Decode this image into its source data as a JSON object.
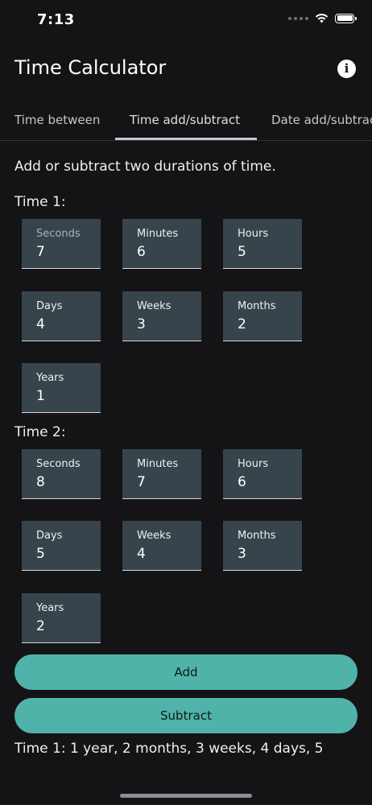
{
  "status": {
    "time": "7:13",
    "icons": [
      "cellular-dots-icon",
      "wifi-icon",
      "battery-icon"
    ]
  },
  "app": {
    "title": "Time Calculator",
    "info_icon": "info-icon",
    "info_glyph": "i"
  },
  "tabs": [
    {
      "label": "Time between",
      "active": false
    },
    {
      "label": "Time add/subtract",
      "active": true
    },
    {
      "label": "Date add/subtract",
      "active": false
    }
  ],
  "description": "Add or subtract two durations of time.",
  "time1": {
    "label": "Time 1:",
    "fields": [
      {
        "label": "Seconds",
        "value": "7"
      },
      {
        "label": "Minutes",
        "value": "6"
      },
      {
        "label": "Hours",
        "value": "5"
      },
      {
        "label": "Days",
        "value": "4"
      },
      {
        "label": "Weeks",
        "value": "3"
      },
      {
        "label": "Months",
        "value": "2"
      },
      {
        "label": "Years",
        "value": "1"
      }
    ]
  },
  "time2": {
    "label": "Time 2:",
    "fields": [
      {
        "label": "Seconds",
        "value": "8"
      },
      {
        "label": "Minutes",
        "value": "7"
      },
      {
        "label": "Hours",
        "value": "6"
      },
      {
        "label": "Days",
        "value": "5"
      },
      {
        "label": "Weeks",
        "value": "4"
      },
      {
        "label": "Months",
        "value": "3"
      },
      {
        "label": "Years",
        "value": "2"
      }
    ]
  },
  "buttons": {
    "add": "Add",
    "subtract": "Subtract"
  },
  "result": "Time 1: 1 year, 2 months, 3 weeks, 4 days, 5",
  "colors": {
    "background": "#141316",
    "field": "#37444b",
    "accent": "#4fb3a9"
  }
}
